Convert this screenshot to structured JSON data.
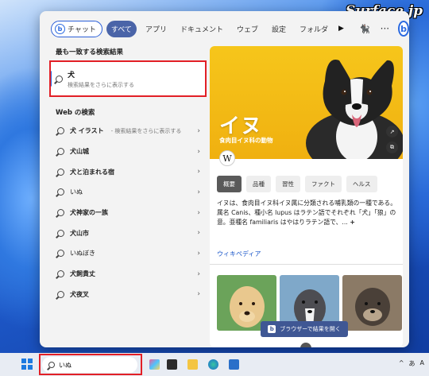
{
  "watermark": "Surface.jp",
  "tabs": {
    "chat": "チャット",
    "items": [
      "すべて",
      "アプリ",
      "ドキュメント",
      "ウェブ",
      "設定",
      "フォルダ"
    ],
    "active_index": 0
  },
  "left": {
    "best_match_heading": "最も一致する検索結果",
    "best_match": {
      "title": "犬",
      "subtitle": "検索結果をさらに表示する"
    },
    "web_heading": "Web の検索",
    "web_results": [
      {
        "text": "犬 イラスト",
        "sub": "- 検索結果をさらに表示する"
      },
      {
        "text": "犬山城",
        "sub": ""
      },
      {
        "text": "犬と泊まれる宿",
        "sub": ""
      },
      {
        "text": "いぬ",
        "sub": ""
      },
      {
        "text": "犬神家の一族",
        "sub": ""
      },
      {
        "text": "犬山市",
        "sub": ""
      },
      {
        "text": "いぬぼき",
        "sub": ""
      },
      {
        "text": "犬飼貴丈",
        "sub": ""
      },
      {
        "text": "犬夜叉",
        "sub": ""
      }
    ]
  },
  "right": {
    "hero_title": "イヌ",
    "hero_subtitle": "食肉目イヌ科の動物",
    "wiki_logo": "W",
    "chips": [
      "概要",
      "品種",
      "習性",
      "ファクト",
      "ヘルス"
    ],
    "description": "イヌは、食肉目イヌ科イヌ属に分類される哺乳類の一種である。属名 Canis、種小名 lupus はラテン語でそれぞれ「犬」「狼」の意。亜種名 familiaris はやはりラテン語で、...",
    "more": "+",
    "wiki_link": "ウィキペディア",
    "open_browser_label": "ブラウザーで結果を開く"
  },
  "taskbar": {
    "search_value": "いぬ",
    "tray": [
      "^",
      "あ",
      "A"
    ]
  },
  "colors": {
    "accent": "#2b6ae0",
    "highlight_box": "#e21f26",
    "hero_bg": "#f6c61b",
    "active_tab": "#4a64a8"
  }
}
